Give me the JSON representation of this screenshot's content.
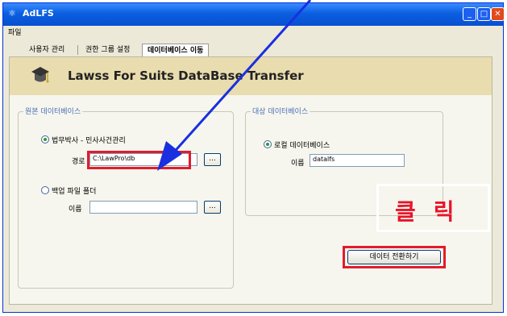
{
  "window": {
    "title": "AdLFS",
    "menu_file": "파일"
  },
  "tabs": [
    {
      "label": "사용자 관리",
      "active": false
    },
    {
      "label": "권한 그룹 설정",
      "active": false
    },
    {
      "label": "데이터베이스 이동",
      "active": true
    }
  ],
  "banner": {
    "title": "Lawss For Suits  DataBase Transfer"
  },
  "source": {
    "group_title": "원본 데이터베이스",
    "option1_label": "법무박사 - 민사사건관리",
    "path_label": "경로",
    "path_value": "C:\\LawPro\\db",
    "option2_label": "백업 파일 폴더",
    "name_label": "이름",
    "name_value": "",
    "browse_label": "..."
  },
  "target": {
    "group_title": "대상 데이터베이스",
    "option_label": "로컬 데이터베이스",
    "name_label": "이름",
    "name_value": "datalfs"
  },
  "annotation": {
    "click_text": "클릭"
  },
  "convert_button": "데이터 전환하기",
  "colors": {
    "accent_red": "#e21b2c",
    "arrow_blue": "#1a2fe0",
    "banner": "#e9dcae"
  }
}
